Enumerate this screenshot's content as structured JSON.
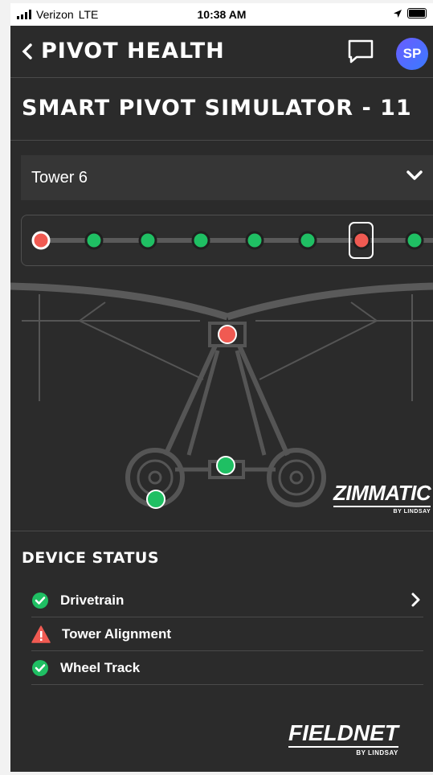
{
  "status_bar": {
    "carrier": "Verizon",
    "network": "LTE",
    "time": "10:38 AM"
  },
  "header": {
    "title": "PIVOT HEALTH",
    "avatar_initials": "SP"
  },
  "page_title": "SMART PIVOT SIMULATOR - 11",
  "tower_select": {
    "value": "Tower 6"
  },
  "tower_strip": {
    "towers": [
      {
        "status": "alert-outline"
      },
      {
        "status": "ok"
      },
      {
        "status": "ok"
      },
      {
        "status": "ok"
      },
      {
        "status": "ok"
      },
      {
        "status": "ok"
      },
      {
        "status": "alert",
        "selected": true
      },
      {
        "status": "ok"
      }
    ]
  },
  "diagram": {
    "sensors": {
      "tower_alignment": "alert",
      "drivetrain": "ok",
      "wheel_track": "ok"
    }
  },
  "brand": {
    "zimmatic": "ZIMMATIC",
    "zimmatic_sub": "BY LINDSAY",
    "fieldnet": "FIELDNET",
    "fieldnet_sub": "BY LINDSAY"
  },
  "device_status": {
    "title": "DEVICE STATUS",
    "items": [
      {
        "label": "Drivetrain",
        "status": "ok",
        "has_detail": true
      },
      {
        "label": "Tower Alignment",
        "status": "warning",
        "has_detail": false
      },
      {
        "label": "Wheel Track",
        "status": "ok",
        "has_detail": false
      }
    ]
  },
  "colors": {
    "ok": "#1fbf63",
    "alert": "#f05a52",
    "background": "#2b2b2b",
    "panel": "#363636"
  }
}
